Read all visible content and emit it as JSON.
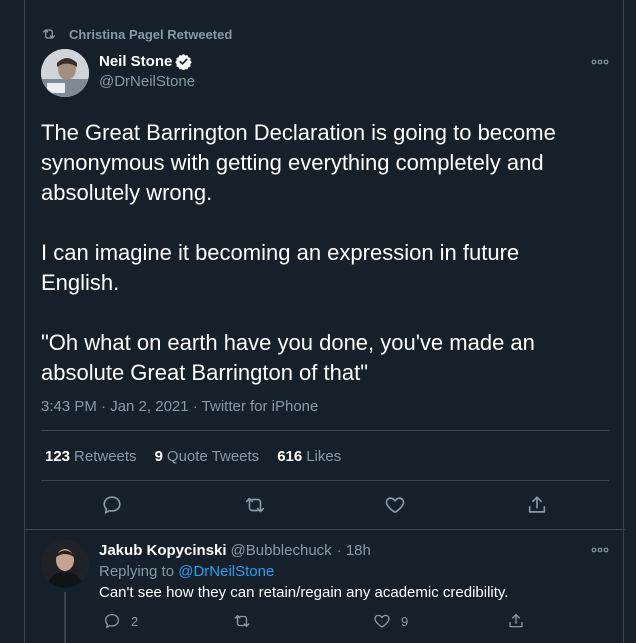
{
  "retweet_banner": {
    "text": "Christina Pagel Retweeted",
    "icon": "retweet-icon"
  },
  "tweet": {
    "author_name": "Neil Stone",
    "author_handle": "@DrNeilStone",
    "text": "The Great Barrington Declaration is going to become synonymous with getting everything completely and absolutely wrong.\n\nI can imagine it becoming an expression in future English.\n\n\"Oh what on earth have you done, you've made an absolute Great Barrington of that\"",
    "meta": "3:43 PM · Jan 2, 2021 · Twitter for iPhone",
    "stats": {
      "retweets_count": "123",
      "retweets_label": "Retweets",
      "quotes_count": "9",
      "quotes_label": "Quote Tweets",
      "likes_count": "616",
      "likes_label": "Likes"
    }
  },
  "reply": {
    "author_name": "Jakub Kopycinski",
    "author_handle": "@Bubblechuck",
    "time": "· 18h",
    "replying_prefix": "Replying to",
    "replying_to": "@DrNeilStone",
    "text": "Can't see how they can retain/regain any academic credibility.",
    "reply_count": "2",
    "like_count": "9"
  },
  "colors": {
    "background": "#15202b",
    "secondary_text": "#8899a6",
    "accent": "#1da1f2",
    "divider": "#38444d"
  }
}
